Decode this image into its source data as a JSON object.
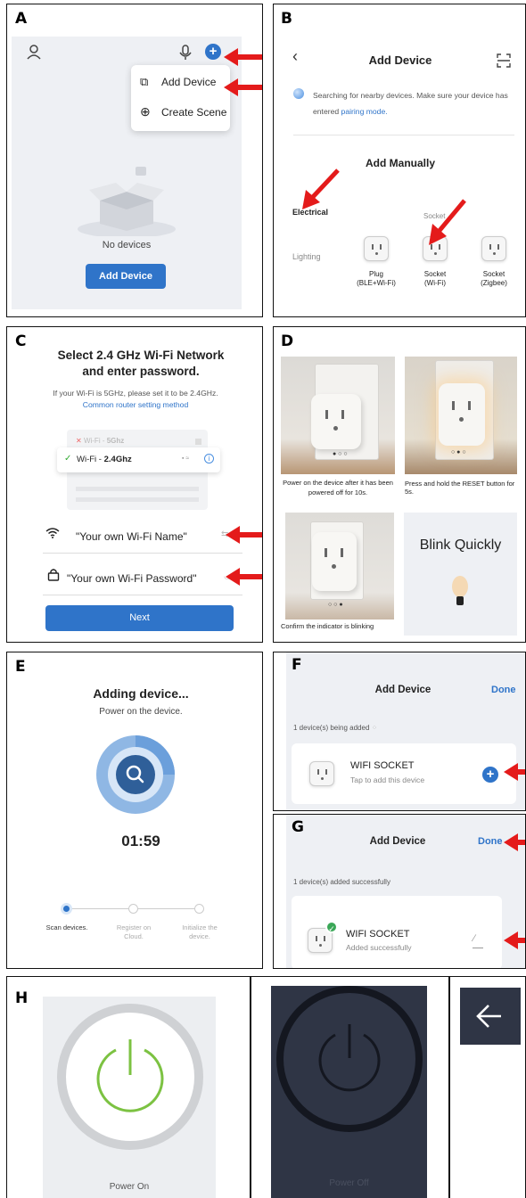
{
  "panels": {
    "a": {
      "label": "A",
      "menu_items": [
        "Add Device",
        "Create Scene"
      ],
      "empty_text": "No devices",
      "add_button": "Add Device"
    },
    "b": {
      "label": "B",
      "title": "Add Device",
      "search_text": "Searching for nearby devices. Make sure your device has entered",
      "pairing_link": "pairing mode.",
      "section_title": "Add Manually",
      "categories": [
        "Electrical",
        "Lighting"
      ],
      "group_label": "Socket",
      "devices": [
        {
          "name": "Plug",
          "sub": "(BLE+Wi-Fi)"
        },
        {
          "name": "Socket",
          "sub": "(Wi-Fi)"
        },
        {
          "name": "Socket",
          "sub": "(Zigbee)"
        }
      ]
    },
    "c": {
      "label": "C",
      "title_line1": "Select 2.4 GHz Wi-Fi Network",
      "title_line2": "and enter password.",
      "hint": "If your Wi-Fi is 5GHz, please set it to be 2.4GHz.",
      "hint_link": "Common router setting method",
      "wifi_bad_prefix": "Wi-Fi - ",
      "wifi_bad": "5Ghz",
      "wifi_good_prefix": "Wi-Fi - ",
      "wifi_good": "2.4Ghz",
      "wifi_name": "\"Your own Wi-Fi Name\"",
      "wifi_password": "\"Your own Wi-Fi Password\"",
      "next_button": "Next"
    },
    "d": {
      "label": "D",
      "caption1": "Power on the device after it has been powered off for 10s.",
      "caption2": "Press and hold the RESET button for 5s.",
      "caption3": "Confirm the indicator is blinking",
      "blink_text": "Blink Quickly"
    },
    "e": {
      "label": "E",
      "title": "Adding device...",
      "subtitle": "Power on the device.",
      "timer": "01:59",
      "steps": [
        "Scan devices.",
        "Register on Cloud.",
        "Initialize the device."
      ]
    },
    "f": {
      "label": "F",
      "title": "Add Device",
      "done": "Done",
      "status": "1 device(s) being added",
      "device_name": "WIFI SOCKET",
      "device_sub": "Tap to add this device"
    },
    "g": {
      "label": "G",
      "title": "Add Device",
      "done": "Done",
      "status": "1 device(s) added successfully",
      "device_name": "WIFI SOCKET",
      "device_sub": "Added successfully"
    },
    "h": {
      "label": "H",
      "power_on": "Power On",
      "power_off": "Power Off"
    }
  },
  "colors": {
    "accent_blue": "#2f74c9",
    "arrow_red": "#e41b1b",
    "power_green": "#7cc242",
    "dark_panel": "#2f3545"
  }
}
